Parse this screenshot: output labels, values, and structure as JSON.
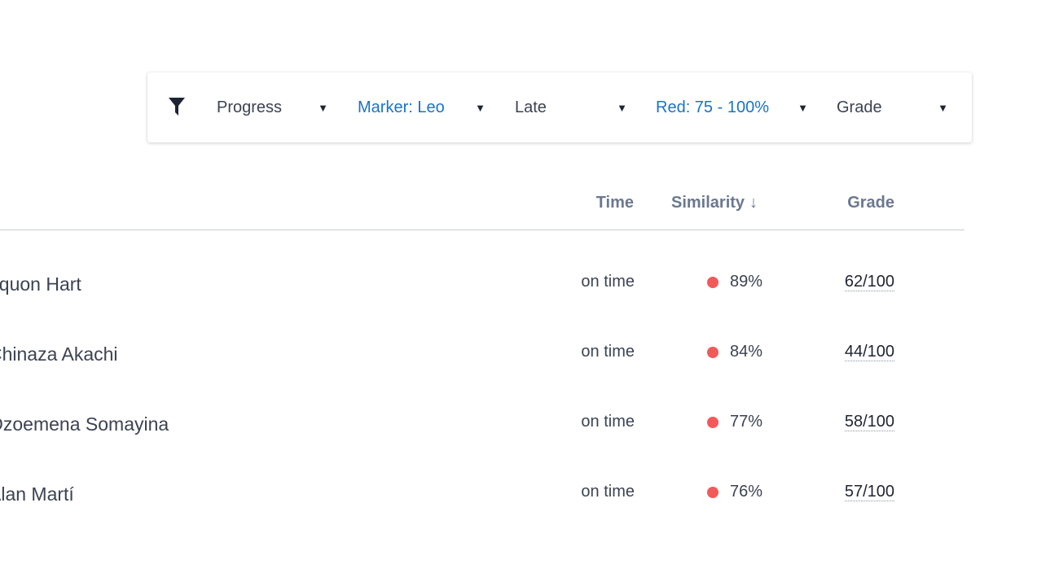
{
  "filters": {
    "icon": "filter-icon",
    "items": [
      {
        "label": "Progress",
        "active": false
      },
      {
        "label": "Marker: Leo",
        "active": true
      },
      {
        "label": "Late",
        "active": false
      },
      {
        "label": "Red: 75 - 100%",
        "active": true
      },
      {
        "label": "Grade",
        "active": false
      }
    ],
    "caret": "▼",
    "active_color": "#1a73c8"
  },
  "table": {
    "columns": {
      "time": "Time",
      "similarity": "Similarity",
      "similarity_sort_arrow": "↓",
      "grade": "Grade"
    },
    "rows": [
      {
        "name": "aquon Hart",
        "time": "on time",
        "similarity": "89%",
        "grade": "62/100"
      },
      {
        "name": "Chinaza Akachi",
        "time": "on time",
        "similarity": "84%",
        "grade": "44/100"
      },
      {
        "name": "Ozoemena Somayina",
        "time": "on time",
        "similarity": "77%",
        "grade": "58/100"
      },
      {
        "name": "Alan Martí",
        "time": "on time",
        "similarity": "76%",
        "grade": "57/100"
      }
    ],
    "similarity_dot_color": "#f25a5a"
  }
}
